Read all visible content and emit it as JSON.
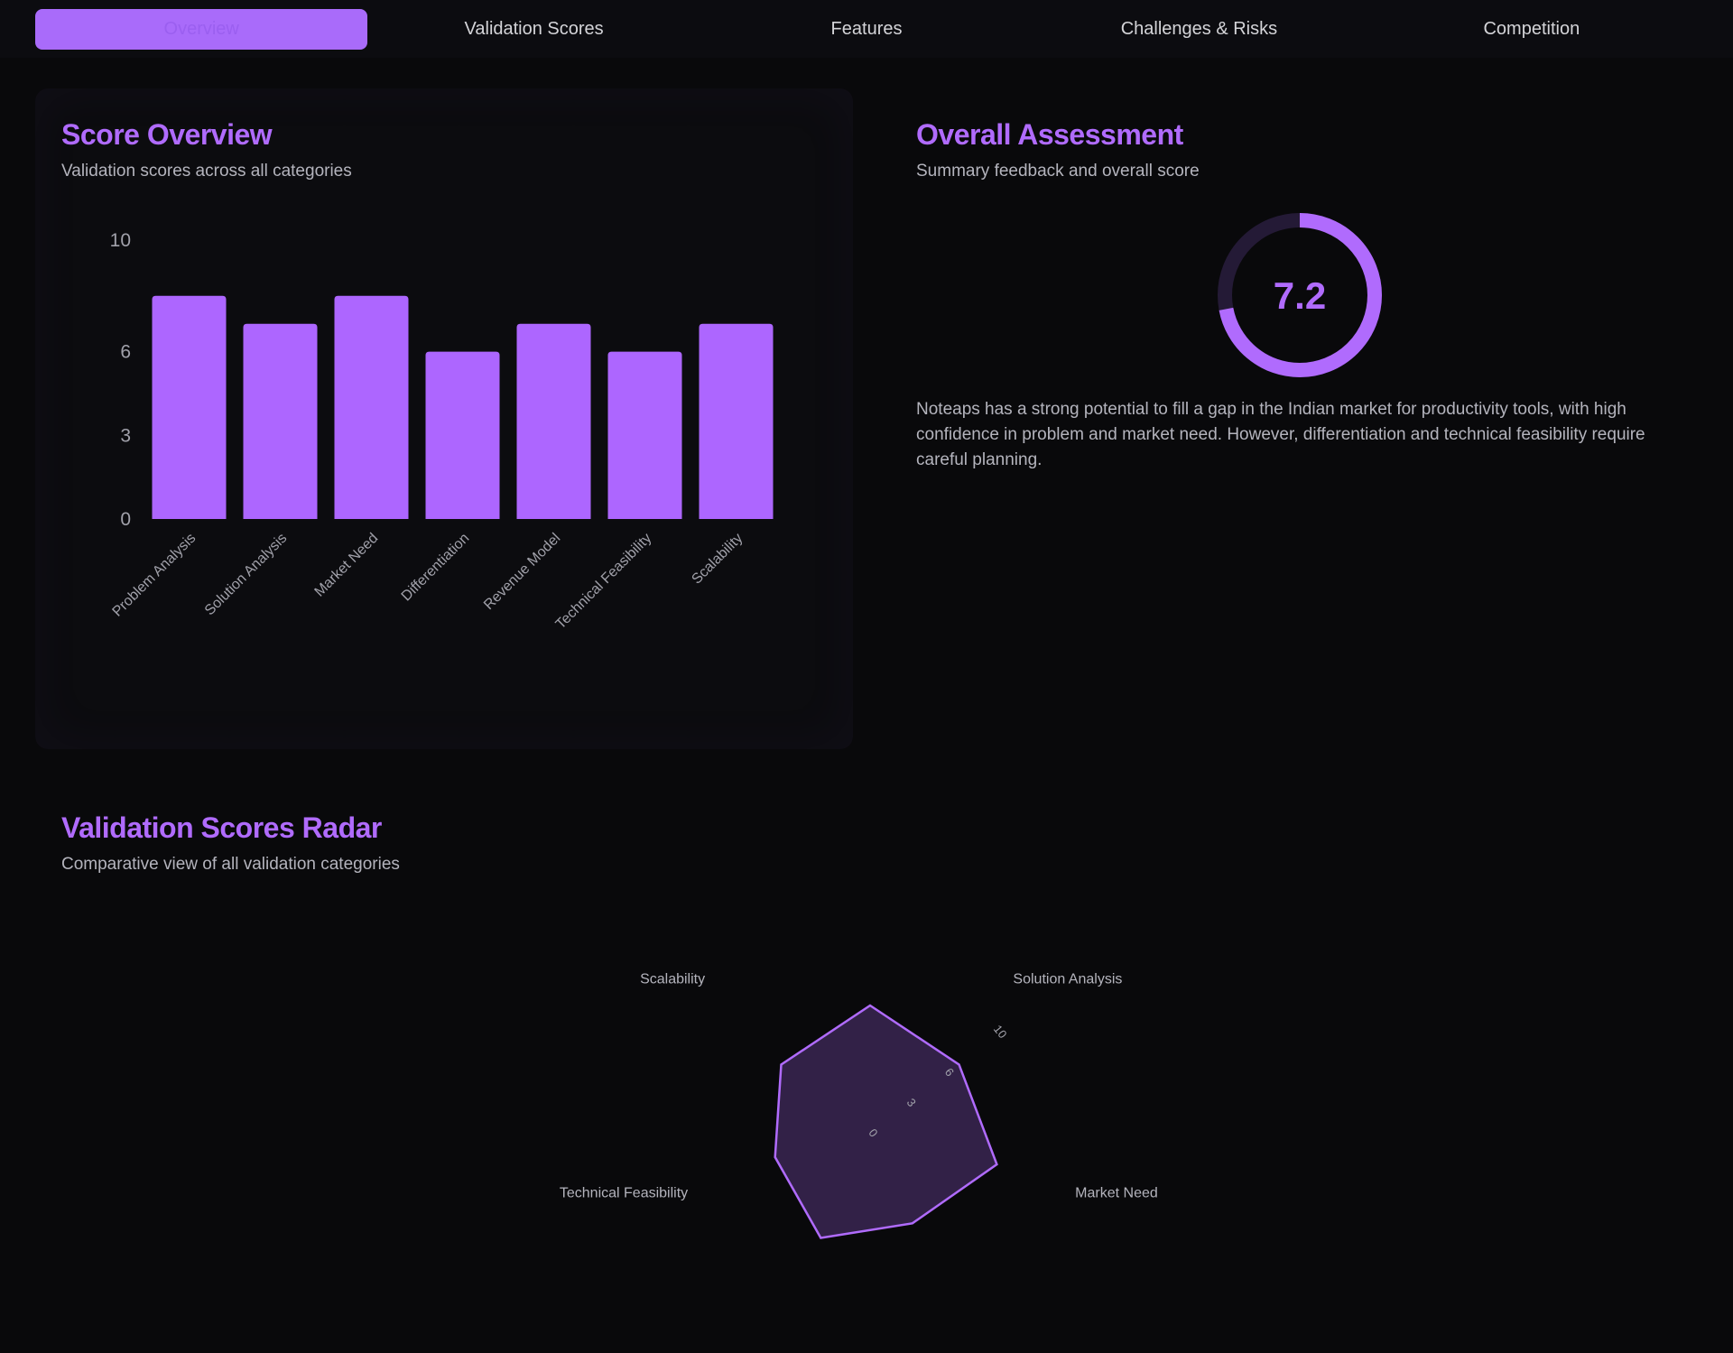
{
  "tabs": [
    {
      "label": "Overview",
      "active": true
    },
    {
      "label": "Validation Scores",
      "active": false
    },
    {
      "label": "Features",
      "active": false
    },
    {
      "label": "Challenges & Risks",
      "active": false
    },
    {
      "label": "Competition",
      "active": false
    }
  ],
  "score_overview": {
    "title": "Score Overview",
    "subtitle": "Validation scores across all categories"
  },
  "overall_assessment": {
    "title": "Overall Assessment",
    "subtitle": "Summary feedback and overall score",
    "score": "7.2",
    "score_value": 7.2,
    "score_max": 10,
    "summary": "Noteaps has a strong potential to fill a gap in the Indian market for productivity tools, with high confidence in problem and market need. However, differentiation and technical feasibility require careful planning."
  },
  "radar_section": {
    "title": "Validation Scores Radar",
    "subtitle": "Comparative view of all validation categories"
  },
  "colors": {
    "accent": "#b06bfd",
    "bar": "#ad66ff",
    "background": "#09090b"
  },
  "chart_data": [
    {
      "type": "bar",
      "categories": [
        "Problem Analysis",
        "Solution Analysis",
        "Market Need",
        "Differentiation",
        "Revenue Model",
        "Technical Feasibility",
        "Scalability"
      ],
      "values": [
        8,
        7,
        8,
        6,
        7,
        6,
        7
      ],
      "yticks": [
        "0",
        "3",
        "6",
        "10"
      ],
      "ylim": [
        0,
        10
      ],
      "grid": false
    },
    {
      "type": "radar",
      "categories": [
        "Problem Analysis",
        "Solution Analysis",
        "Market Need",
        "Differentiation",
        "Revenue Model",
        "Technical Feasibility",
        "Scalability"
      ],
      "values": [
        8,
        7,
        8,
        6,
        7,
        6,
        7
      ],
      "ticks": [
        "0",
        "3",
        "6",
        "10"
      ],
      "range": [
        0,
        10
      ]
    }
  ]
}
